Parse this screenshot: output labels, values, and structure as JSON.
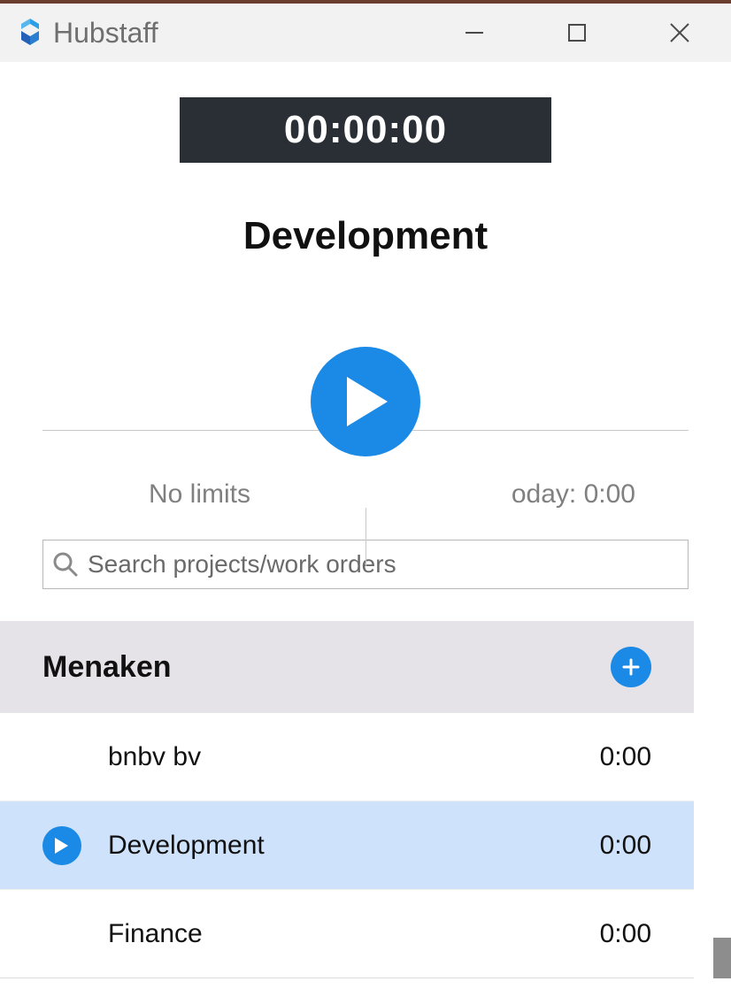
{
  "app": {
    "name": "Hubstaff"
  },
  "timer": {
    "display": "00:00:00"
  },
  "current_project": "Development",
  "limits_label": "No limits",
  "today_label": "oday: 0:00",
  "search": {
    "placeholder": "Search projects/work orders",
    "value": ""
  },
  "org": {
    "name": "Menaken"
  },
  "projects": [
    {
      "name": "bnbv bv",
      "time": "0:00",
      "selected": false
    },
    {
      "name": "Development",
      "time": "0:00",
      "selected": true
    },
    {
      "name": "Finance",
      "time": "0:00",
      "selected": false
    }
  ]
}
